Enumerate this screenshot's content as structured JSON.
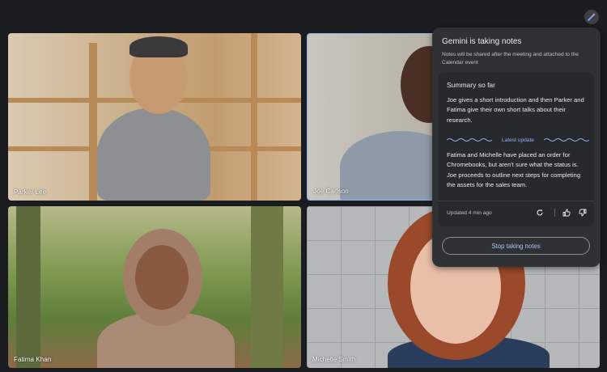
{
  "participants": [
    {
      "name": "Parker Lee"
    },
    {
      "name": "Joe Carlson"
    },
    {
      "name": "Fatima Khan"
    },
    {
      "name": "Michelle Smith"
    }
  ],
  "gemini_panel": {
    "title": "Gemini is taking notes",
    "subtitle": "Notes will be shared after the meeting and attached to the Calendar event",
    "summary_title": "Summary so far",
    "summary_text_1": "Joe gives a short introduction and then Parker and Fatima give their own short talks about their research.",
    "latest_update_label": "Latest update",
    "summary_text_2": "Fatima and Michelle have placed an order for Chromebooks, but aren't sure what the status is. Joe proceeds to outline next steps for completing the assets for the sales team.",
    "updated_text": "Updated 4 min ago",
    "stop_button_label": "Stop taking notes"
  },
  "icons": [
    "gemini-icon",
    "refresh-icon",
    "thumbs-up-icon",
    "thumbs-down-icon"
  ],
  "colors": {
    "background": "#1b1c1f",
    "panel": "#303134",
    "card": "#28292c",
    "accent": "#8ab4f8",
    "active_speaker_border": "#8ab4f8"
  }
}
